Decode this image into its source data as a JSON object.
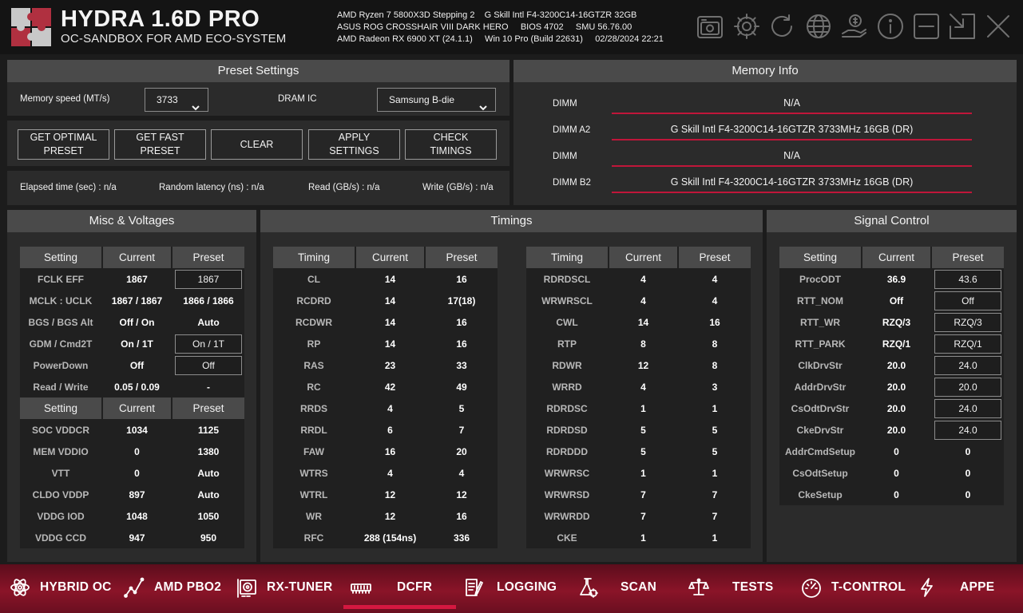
{
  "header": {
    "title": "HYDRA 1.6D PRO",
    "subtitle": "OC-SANDBOX FOR AMD ECO-SYSTEM",
    "sys_line1": "AMD Ryzen 7 5800X3D Stepping 2    G Skill Intl F4-3200C14-16GTZR 32GB",
    "sys_line2": "ASUS ROG CROSSHAIR VIII DARK HERO     BIOS 4702     SMU 56.76.00",
    "sys_line3": "AMD Radeon RX 6900 XT (24.1.1)     Win 10 Pro (Build 22631)     02/28/2024 22:21",
    "icons": [
      "camera-icon",
      "gear-icon",
      "refresh-icon",
      "globe-icon",
      "donate-icon",
      "info-icon",
      "minimize-icon",
      "restore-icon",
      "close-icon"
    ]
  },
  "preset": {
    "title": "Preset Settings",
    "memory_speed_label": "Memory speed (MT/s)",
    "memory_speed_value": "3733",
    "dram_ic_label": "DRAM IC",
    "dram_ic_value": "Samsung B-die",
    "buttons": [
      "GET OPTIMAL\nPRESET",
      "GET FAST\nPRESET",
      "CLEAR",
      "APPLY\nSETTINGS",
      "CHECK\nTIMINGS"
    ],
    "stats": [
      "Elapsed time (sec) : n/a",
      "Random latency (ns) : n/a",
      "Read (GB/s) : n/a",
      "Write (GB/s) : n/a"
    ]
  },
  "memory_info": {
    "title": "Memory Info",
    "dimms": [
      {
        "label": "DIMM",
        "value": "N/A"
      },
      {
        "label": "DIMM A2",
        "value": "G Skill Intl F4-3200C14-16GTZR 3733MHz 16GB (DR)"
      },
      {
        "label": "DIMM",
        "value": "N/A"
      },
      {
        "label": "DIMM B2",
        "value": "G Skill Intl F4-3200C14-16GTZR 3733MHz 16GB (DR)"
      }
    ]
  },
  "misc": {
    "title": "Misc & Voltages",
    "headers": [
      "Setting",
      "Current",
      "Preset"
    ],
    "rows": [
      [
        "FCLK EFF",
        "1867",
        "1867"
      ],
      [
        "MCLK : UCLK",
        "1867  /  1867",
        "1866 / 1866"
      ],
      [
        "BGS / BGS Alt",
        "Off / On",
        "Auto"
      ],
      [
        "GDM / Cmd2T",
        "On / 1T",
        "On / 1T"
      ],
      [
        "PowerDown",
        "Off",
        "Off"
      ],
      [
        "Read / Write",
        "0.05  /  0.09",
        "-"
      ]
    ],
    "headers2": [
      "Setting",
      "Current",
      "Preset"
    ],
    "rows2": [
      [
        "SOC VDDCR",
        "1034",
        "1125"
      ],
      [
        "MEM VDDIO",
        "0",
        "1380"
      ],
      [
        "VTT",
        "0",
        "Auto"
      ],
      [
        "CLDO VDDP",
        "897",
        "Auto"
      ],
      [
        "VDDG IOD",
        "1048",
        "1050"
      ],
      [
        "VDDG CCD",
        "947",
        "950"
      ]
    ]
  },
  "timings": {
    "title": "Timings",
    "headers": [
      "Timing",
      "Current",
      "Preset"
    ],
    "left": [
      [
        "CL",
        "14",
        "16"
      ],
      [
        "RCDRD",
        "14",
        "17(18)"
      ],
      [
        "RCDWR",
        "14",
        "16"
      ],
      [
        "RP",
        "14",
        "16"
      ],
      [
        "RAS",
        "23",
        "33"
      ],
      [
        "RC",
        "42",
        "49"
      ],
      [
        "RRDS",
        "4",
        "5"
      ],
      [
        "RRDL",
        "6",
        "7"
      ],
      [
        "FAW",
        "16",
        "20"
      ],
      [
        "WTRS",
        "4",
        "4"
      ],
      [
        "WTRL",
        "12",
        "12"
      ],
      [
        "WR",
        "12",
        "16"
      ],
      [
        "RFC",
        "288 (154ns)",
        "336"
      ]
    ],
    "right": [
      [
        "RDRDSCL",
        "4",
        "4"
      ],
      [
        "WRWRSCL",
        "4",
        "4"
      ],
      [
        "CWL",
        "14",
        "16"
      ],
      [
        "RTP",
        "8",
        "8"
      ],
      [
        "RDWR",
        "12",
        "8"
      ],
      [
        "WRRD",
        "4",
        "3"
      ],
      [
        "RDRDSC",
        "1",
        "1"
      ],
      [
        "RDRDSD",
        "5",
        "5"
      ],
      [
        "RDRDDD",
        "5",
        "5"
      ],
      [
        "WRWRSC",
        "1",
        "1"
      ],
      [
        "WRWRSD",
        "7",
        "7"
      ],
      [
        "WRWRDD",
        "7",
        "7"
      ],
      [
        "CKE",
        "1",
        "1"
      ]
    ]
  },
  "signal": {
    "title": "Signal Control",
    "headers": [
      "Setting",
      "Current",
      "Preset"
    ],
    "rows": [
      [
        "ProcODT",
        "36.9",
        "43.6"
      ],
      [
        "RTT_NOM",
        "Off",
        "Off"
      ],
      [
        "RTT_WR",
        "RZQ/3",
        "RZQ/3"
      ],
      [
        "RTT_PARK",
        "RZQ/1",
        "RZQ/1"
      ],
      [
        "ClkDrvStr",
        "20.0",
        "24.0"
      ],
      [
        "AddrDrvStr",
        "20.0",
        "20.0"
      ],
      [
        "CsOdtDrvStr",
        "20.0",
        "24.0"
      ],
      [
        "CkeDrvStr",
        "20.0",
        "24.0"
      ],
      [
        "AddrCmdSetup",
        "0",
        "0"
      ],
      [
        "CsOdtSetup",
        "0",
        "0"
      ],
      [
        "CkeSetup",
        "0",
        "0"
      ]
    ]
  },
  "nav": {
    "items": [
      {
        "label": "HYBRID OC",
        "icon": "atom-icon"
      },
      {
        "label": "AMD PBO2",
        "icon": "graph-icon"
      },
      {
        "label": "RX-TUNER",
        "icon": "gpu-icon"
      },
      {
        "label": "DCFR",
        "icon": "memory-icon"
      },
      {
        "label": "LOGGING",
        "icon": "log-icon"
      },
      {
        "label": "SCAN",
        "icon": "flask-icon"
      },
      {
        "label": "TESTS",
        "icon": "scale-icon"
      },
      {
        "label": "T-CONTROL",
        "icon": "gauge-icon"
      },
      {
        "label": "APPE",
        "icon": "bolt-icon"
      }
    ],
    "active": "DCFR"
  },
  "colors": {
    "accent": "#c0163a",
    "nav_bg": "#8a1428",
    "panel_title": "#4a4a4a"
  }
}
